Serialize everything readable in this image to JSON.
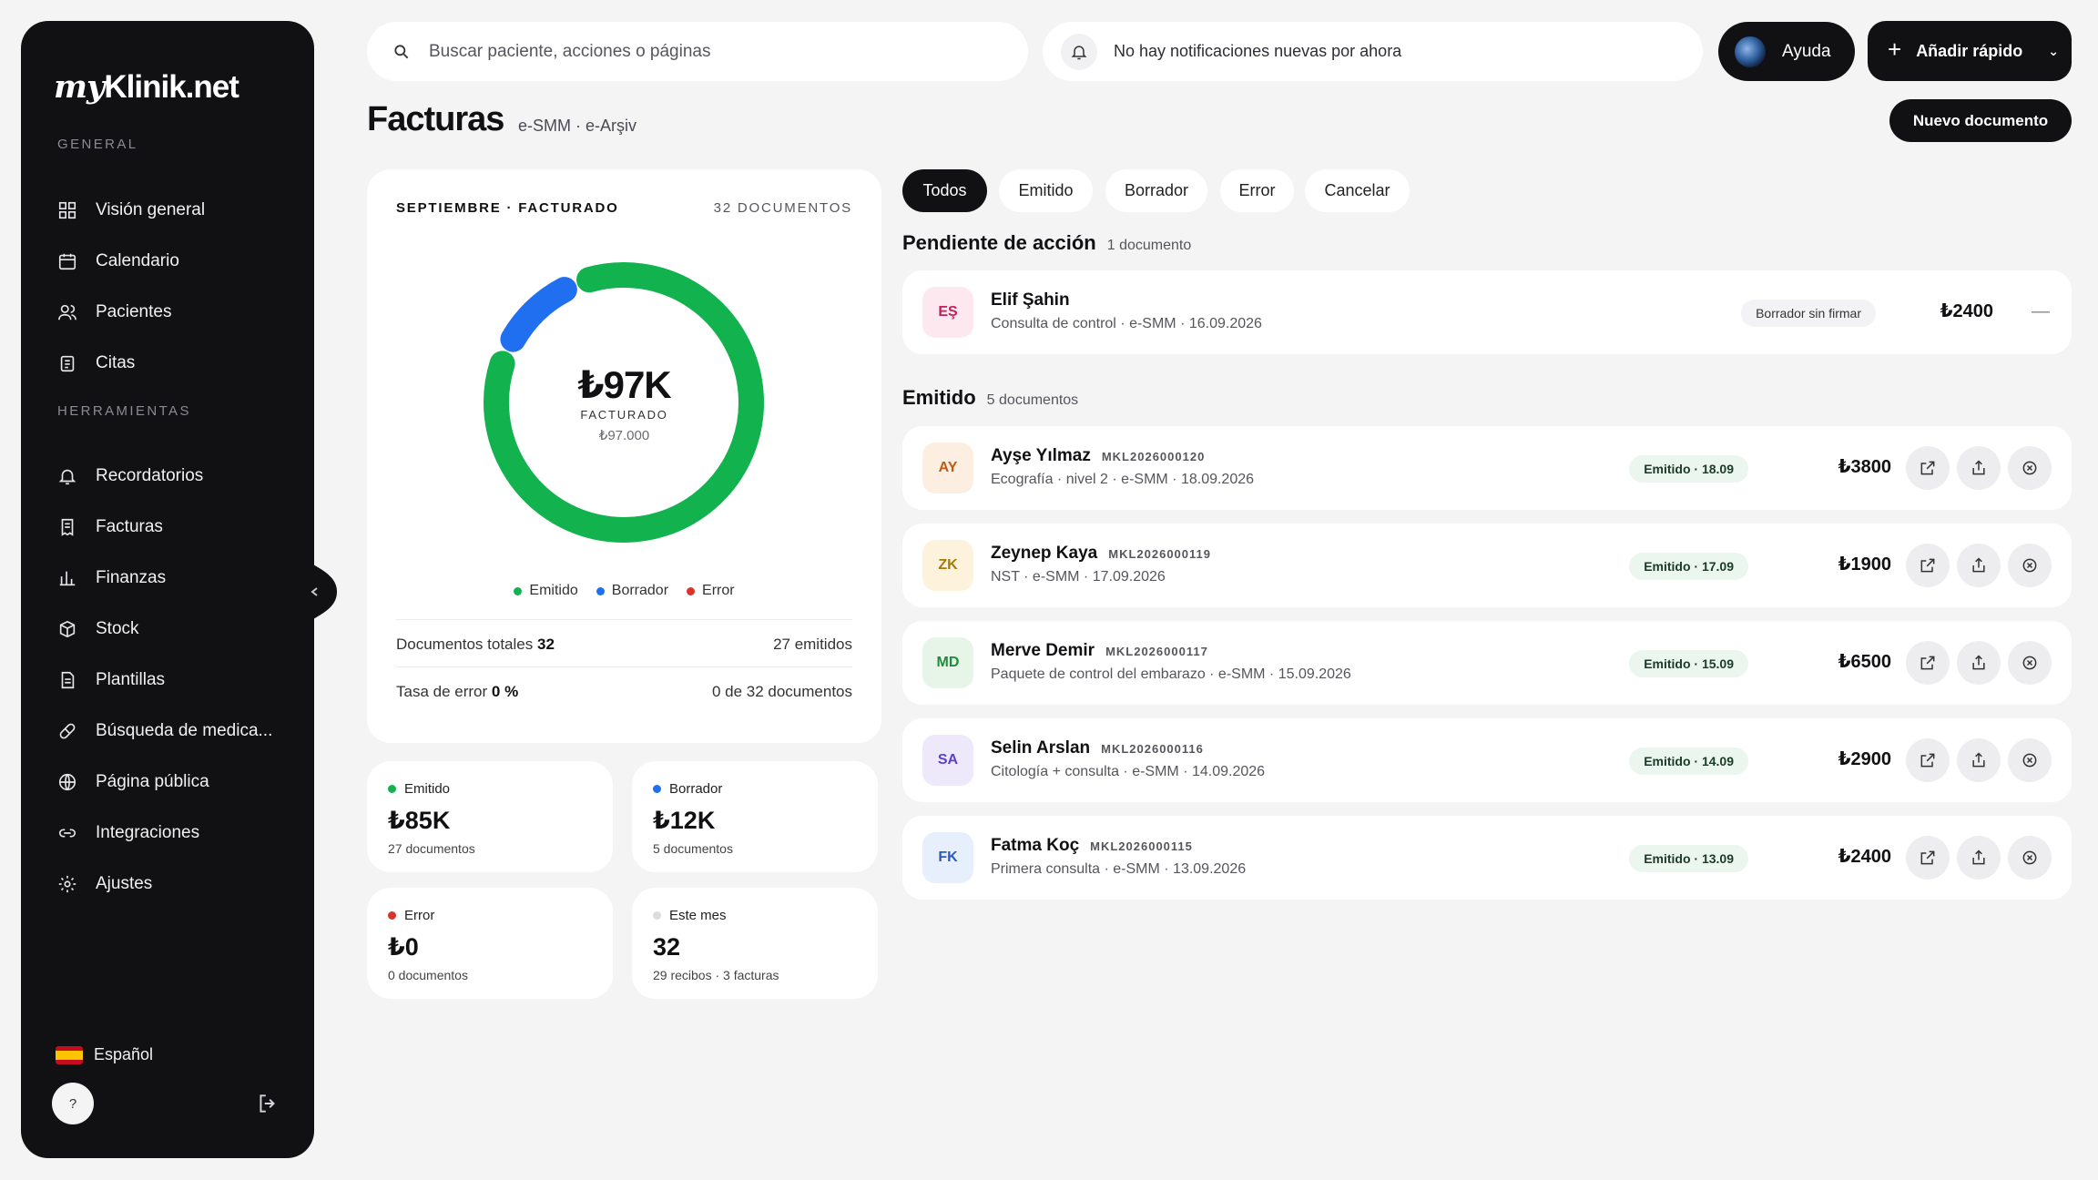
{
  "brand": {
    "logo_script": "my",
    "logo_rest": "Klinik.net"
  },
  "sidebar": {
    "general_title": "GENERAL",
    "general_items": [
      {
        "label": "Visión general",
        "icon": "grid-icon"
      },
      {
        "label": "Calendario",
        "icon": "calendar-icon"
      },
      {
        "label": "Pacientes",
        "icon": "users-icon"
      },
      {
        "label": "Citas",
        "icon": "clipboard-icon"
      }
    ],
    "tools_title": "HERRAMIENTAS",
    "tools_items": [
      {
        "label": "Recordatorios",
        "icon": "bell-icon"
      },
      {
        "label": "Facturas",
        "icon": "receipt-icon"
      },
      {
        "label": "Finanzas",
        "icon": "bar-chart-icon"
      },
      {
        "label": "Stock",
        "icon": "box-icon"
      },
      {
        "label": "Plantillas",
        "icon": "document-icon"
      },
      {
        "label": "Búsqueda de medica...",
        "icon": "pill-icon"
      },
      {
        "label": "Página pública",
        "icon": "globe-icon"
      },
      {
        "label": "Integraciones",
        "icon": "link-icon"
      },
      {
        "label": "Ajustes",
        "icon": "gear-icon"
      }
    ],
    "language": "Español",
    "help_label": "?"
  },
  "topbar": {
    "search_placeholder": "Buscar paciente, acciones o páginas",
    "notification_text": "No hay notificaciones nuevas por ahora",
    "help_button": "Ayuda",
    "quick_add_button": "Añadir rápido"
  },
  "page": {
    "title": "Facturas",
    "subtitle": "e-SMM · e-Arşiv",
    "new_document_button": "Nuevo documento"
  },
  "summary": {
    "header_left": "SEPTIEMBRE · FACTURADO",
    "header_right": "32 DOCUMENTOS",
    "total_value": "₺97K",
    "total_label": "FACTURADO",
    "total_exact": "₺97.000",
    "legend": [
      {
        "label": "Emitido",
        "color": "#12b24f"
      },
      {
        "label": "Borrador",
        "color": "#1f6ff0"
      },
      {
        "label": "Error",
        "color": "#d8342c"
      }
    ],
    "donut": {
      "emitido": 85,
      "borrador": 12,
      "error": 0
    },
    "total_docs_label": "Documentos totales",
    "total_docs_value": "32",
    "total_docs_right": "27 emitidos",
    "error_rate_label": "Tasa de error",
    "error_rate_value": "0 %",
    "error_rate_right": "0 de 32 documentos"
  },
  "stats": [
    {
      "label": "Emitido",
      "value": "₺85K",
      "sub": "27 documentos",
      "color": "#12b24f"
    },
    {
      "label": "Borrador",
      "value": "₺12K",
      "sub": "5 documentos",
      "color": "#1f6ff0"
    },
    {
      "label": "Error",
      "value": "₺0",
      "sub": "0 documentos",
      "color": "#d8342c"
    },
    {
      "label": "Este mes",
      "value": "32",
      "sub": "29 recibos · 3 facturas",
      "color": "#dcdce0"
    }
  ],
  "filters": [
    "Todos",
    "Emitido",
    "Borrador",
    "Error",
    "Cancelar"
  ],
  "pending": {
    "title": "Pendiente de acción",
    "count": "1 documento",
    "items": [
      {
        "initials": "EŞ",
        "name": "Elif Şahin",
        "desc": "Consulta de control · e-SMM · 16.09.2026",
        "badge": "Borrador sin firmar",
        "amount": "₺2400",
        "extra": "—"
      }
    ]
  },
  "issued": {
    "title": "Emitido",
    "count": "5 documentos",
    "items": [
      {
        "initials": "AY",
        "name": "Ayşe Yılmaz",
        "ref": "MKL2026000120",
        "desc": "Ecografía · nivel 2 · e-SMM · 18.09.2026",
        "badge": "Emitido · 18.09",
        "amount": "₺3800"
      },
      {
        "initials": "ZK",
        "name": "Zeynep Kaya",
        "ref": "MKL2026000119",
        "desc": "NST · e-SMM · 17.09.2026",
        "badge": "Emitido · 17.09",
        "amount": "₺1900"
      },
      {
        "initials": "MD",
        "name": "Merve Demir",
        "ref": "MKL2026000117",
        "desc": "Paquete de control del embarazo · e-SMM · 15.09.2026",
        "badge": "Emitido · 15.09",
        "amount": "₺6500"
      },
      {
        "initials": "SA",
        "name": "Selin Arslan",
        "ref": "MKL2026000116",
        "desc": "Citología + consulta · e-SMM · 14.09.2026",
        "badge": "Emitido · 14.09",
        "amount": "₺2900"
      },
      {
        "initials": "FK",
        "name": "Fatma Koç",
        "ref": "MKL2026000115",
        "desc": "Primera consulta · e-SMM · 13.09.2026",
        "badge": "Emitido · 13.09",
        "amount": "₺2400"
      }
    ]
  }
}
